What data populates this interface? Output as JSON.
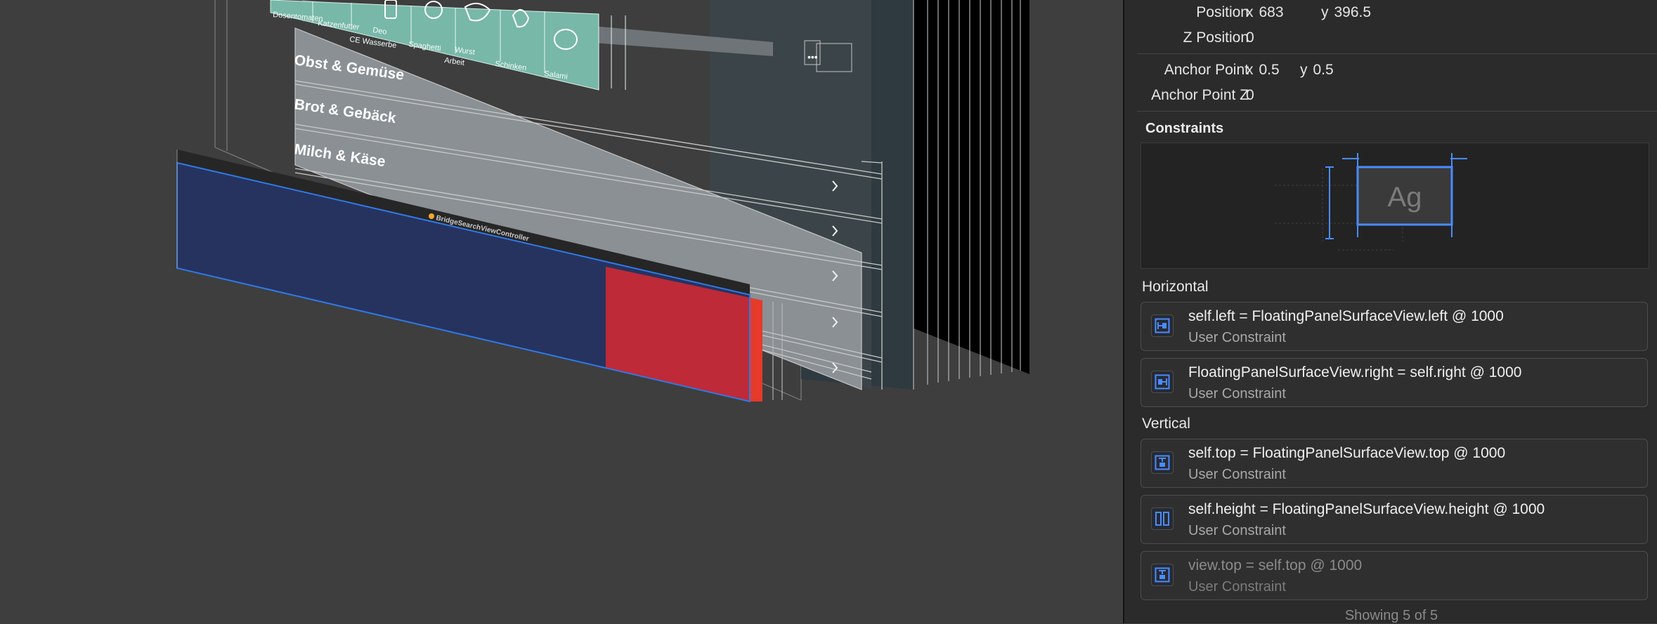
{
  "canvas": {
    "categories": [
      "Obst & Gemüse",
      "Brot & Gebäck",
      "Milch & Käse"
    ],
    "chips": [
      "Dosentomaten",
      "Katzenfutter",
      "CE Wasserbe",
      "Deo",
      "Spaghetti",
      "Arbeit",
      "Wurst",
      "Schinken",
      "Salami"
    ],
    "controller_label": "BridgeSearchViewController",
    "colors": {
      "teal": "#78b8a8",
      "navy": "#26335f",
      "red": "#be2a38",
      "selection": "#2f79e8"
    }
  },
  "inspector": {
    "position": {
      "label": "Position",
      "x_key": "x",
      "x": "683",
      "y_key": "y",
      "y": "396.5"
    },
    "z_position": {
      "label": "Z Position",
      "value": "0"
    },
    "anchor_point": {
      "label": "Anchor Point",
      "x_key": "x",
      "x": "0.5",
      "y_key": "y",
      "y": "0.5"
    },
    "anchor_point_z": {
      "label": "Anchor Point Z",
      "value": "0"
    },
    "constraints_title": "Constraints",
    "preview_text": "Ag",
    "horizontal_title": "Horizontal",
    "vertical_title": "Vertical",
    "horizontal": [
      {
        "title": "self.left = FloatingPanelSurfaceView.left @ 1000",
        "subtitle": "User Constraint",
        "icon": "leading-constraint-icon"
      },
      {
        "title": "FloatingPanelSurfaceView.right = self.right @ 1000",
        "subtitle": "User Constraint",
        "icon": "trailing-constraint-icon"
      }
    ],
    "vertical": [
      {
        "title": "self.top = FloatingPanelSurfaceView.top @ 1000",
        "subtitle": "User Constraint",
        "icon": "top-constraint-icon"
      },
      {
        "title": "self.height = FloatingPanelSurfaceView.height @ 1000",
        "subtitle": "User Constraint",
        "icon": "height-constraint-icon"
      },
      {
        "title": "view.top = self.top @ 1000",
        "subtitle": "User Constraint",
        "icon": "top-constraint-icon",
        "disabled": true
      }
    ],
    "footer": "Showing 5 of 5",
    "accent": "#4a8cff"
  }
}
